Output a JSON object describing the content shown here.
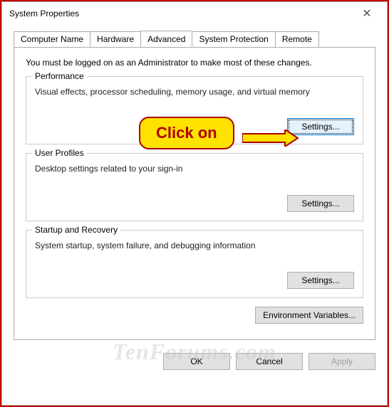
{
  "window": {
    "title": "System Properties",
    "close": "✕"
  },
  "tabs": {
    "computer_name": "Computer Name",
    "hardware": "Hardware",
    "advanced": "Advanced",
    "system_protection": "System Protection",
    "remote": "Remote"
  },
  "panel": {
    "admin_note": "You must be logged on as an Administrator to make most of these changes.",
    "performance": {
      "title": "Performance",
      "desc": "Visual effects, processor scheduling, memory usage, and virtual memory",
      "button": "Settings..."
    },
    "user_profiles": {
      "title": "User Profiles",
      "desc": "Desktop settings related to your sign-in",
      "button": "Settings..."
    },
    "startup": {
      "title": "Startup and Recovery",
      "desc": "System startup, system failure, and debugging information",
      "button": "Settings..."
    },
    "env_button": "Environment Variables..."
  },
  "buttons": {
    "ok": "OK",
    "cancel": "Cancel",
    "apply": "Apply"
  },
  "callout": {
    "text": "Click on"
  },
  "watermark": "TenForums.com"
}
